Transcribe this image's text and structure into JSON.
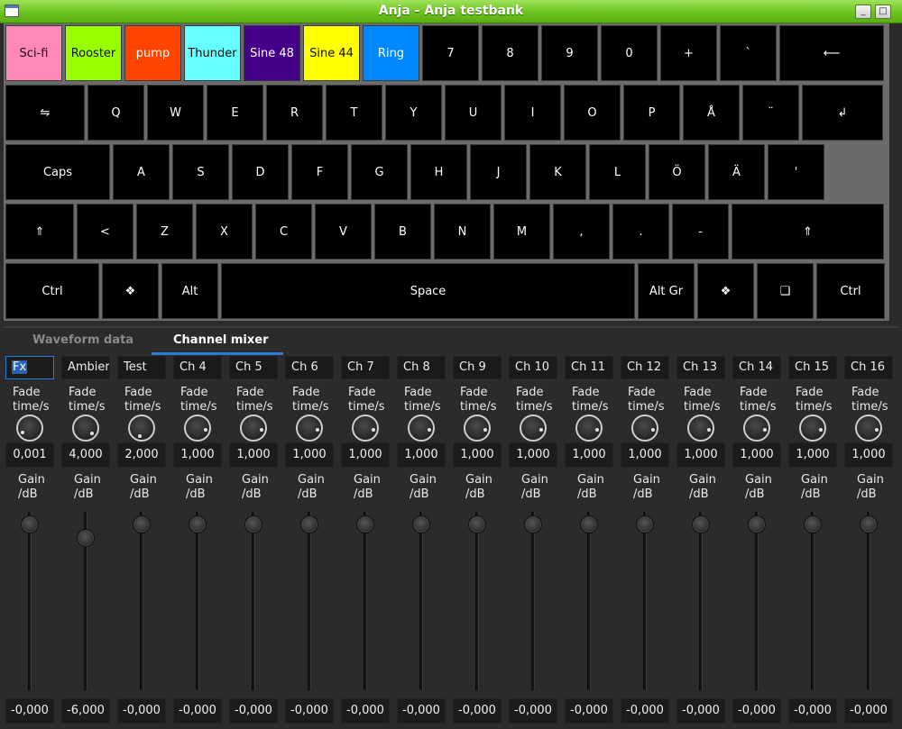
{
  "window": {
    "title": "Anja - Anja testbank",
    "minimize_label": "_",
    "maximize_label": "□"
  },
  "keyboard": {
    "row1": [
      {
        "label": "Sci-fi",
        "color": "#ff88bb"
      },
      {
        "label": "Rooster",
        "color": "#99ff00"
      },
      {
        "label": "pump",
        "color": "#ff4400"
      },
      {
        "label": "Thunder",
        "color": "#66ffff"
      },
      {
        "label": "Sine 48",
        "color": "#440088"
      },
      {
        "label": "Sine 44",
        "color": "#ffff00"
      },
      {
        "label": "Ring",
        "color": "#0088ff"
      },
      {
        "label": "7"
      },
      {
        "label": "8"
      },
      {
        "label": "9"
      },
      {
        "label": "0"
      },
      {
        "label": "+"
      },
      {
        "label": "`"
      },
      {
        "label": "⟵"
      }
    ],
    "row2": [
      "⇋",
      "Q",
      "W",
      "E",
      "R",
      "T",
      "Y",
      "U",
      "I",
      "O",
      "P",
      "Å",
      "¨",
      "↲"
    ],
    "row3": [
      "Caps",
      "A",
      "S",
      "D",
      "F",
      "G",
      "H",
      "J",
      "K",
      "L",
      "Ö",
      "Ä",
      "'"
    ],
    "row4": [
      "⇑",
      "<",
      "Z",
      "X",
      "C",
      "V",
      "B",
      "N",
      "M",
      ",",
      ".",
      "-",
      "⇑"
    ],
    "row5": [
      "Ctrl",
      "❖",
      "Alt",
      "Space",
      "Alt Gr",
      "❖",
      "❑",
      "Ctrl"
    ]
  },
  "tabs": [
    {
      "label": "Waveform data",
      "active": false
    },
    {
      "label": "Channel mixer",
      "active": true
    }
  ],
  "mixer": {
    "fade_label_1": "Fade",
    "fade_label_2": "time/s",
    "gain_label_1": "Gain",
    "gain_label_2": "/dB",
    "channels": [
      {
        "name": "Fx",
        "fade": "0,001",
        "gain": "-0,000"
      },
      {
        "name": "Ambier",
        "fade": "4,000",
        "gain": "-6,000"
      },
      {
        "name": "Test",
        "fade": "2,000",
        "gain": "-0,000"
      },
      {
        "name": "Ch 4",
        "fade": "1,000",
        "gain": "-0,000"
      },
      {
        "name": "Ch 5",
        "fade": "1,000",
        "gain": "-0,000"
      },
      {
        "name": "Ch 6",
        "fade": "1,000",
        "gain": "-0,000"
      },
      {
        "name": "Ch 7",
        "fade": "1,000",
        "gain": "-0,000"
      },
      {
        "name": "Ch 8",
        "fade": "1,000",
        "gain": "-0,000"
      },
      {
        "name": "Ch 9",
        "fade": "1,000",
        "gain": "-0,000"
      },
      {
        "name": "Ch 10",
        "fade": "1,000",
        "gain": "-0,000"
      },
      {
        "name": "Ch 11",
        "fade": "1,000",
        "gain": "-0,000"
      },
      {
        "name": "Ch 12",
        "fade": "1,000",
        "gain": "-0,000"
      },
      {
        "name": "Ch 13",
        "fade": "1,000",
        "gain": "-0,000"
      },
      {
        "name": "Ch 14",
        "fade": "1,000",
        "gain": "-0,000"
      },
      {
        "name": "Ch 15",
        "fade": "1,000",
        "gain": "-0,000"
      },
      {
        "name": "Ch 16",
        "fade": "1,000",
        "gain": "-0,000"
      }
    ]
  }
}
